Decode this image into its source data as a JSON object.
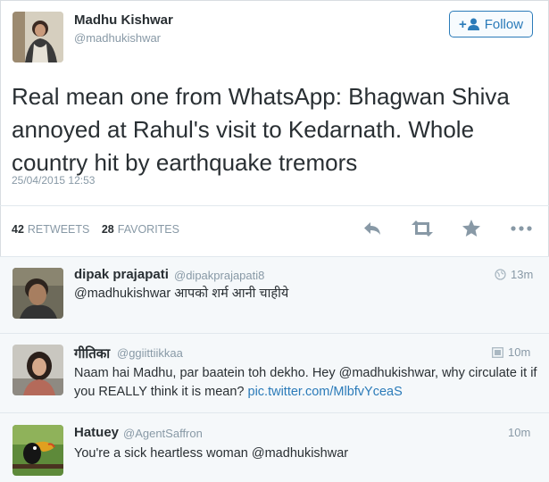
{
  "tweet": {
    "author_name": "Madhu Kishwar",
    "author_handle": "@madhukishwar",
    "follow_label": "Follow",
    "text": "Real mean one from WhatsApp: Bhagwan Shiva annoyed at Rahul's visit to Kedarnath. Whole country hit by earthquake tremors",
    "timestamp": "25/04/2015 12:53",
    "retweets_count": "42",
    "retweets_label": "RETWEETS",
    "favorites_count": "28",
    "favorites_label": "FAVORITES",
    "actions": [
      "reply-icon",
      "retweet-icon",
      "favorite-icon",
      "more-icon"
    ]
  },
  "replies": [
    {
      "name": "dipak prajapati",
      "handle": "@dipakprajapati8",
      "time": "13m",
      "time_icon": "globe-icon",
      "text": "@madhukishwar आपको शर्म आनी चाहीये"
    },
    {
      "name": "गीतिका",
      "handle": "@ggiittiikkaa",
      "time": "10m",
      "time_icon": "photo-icon",
      "text": "Naam hai Madhu, par baatein toh dekho. Hey @madhukishwar, why circulate it if you REALLY think it is mean?",
      "link": "pic.twitter.com/MlbfvYceaS"
    },
    {
      "name": "Hatuey",
      "handle": "@AgentSaffron",
      "time": "10m",
      "text": "You're a sick heartless woman @madhukishwar"
    }
  ],
  "colors": {
    "link_blue": "#2b7bb9",
    "muted_gray": "#8899a6",
    "text_dark": "#292f33",
    "reply_bg": "#f5f8fa"
  }
}
